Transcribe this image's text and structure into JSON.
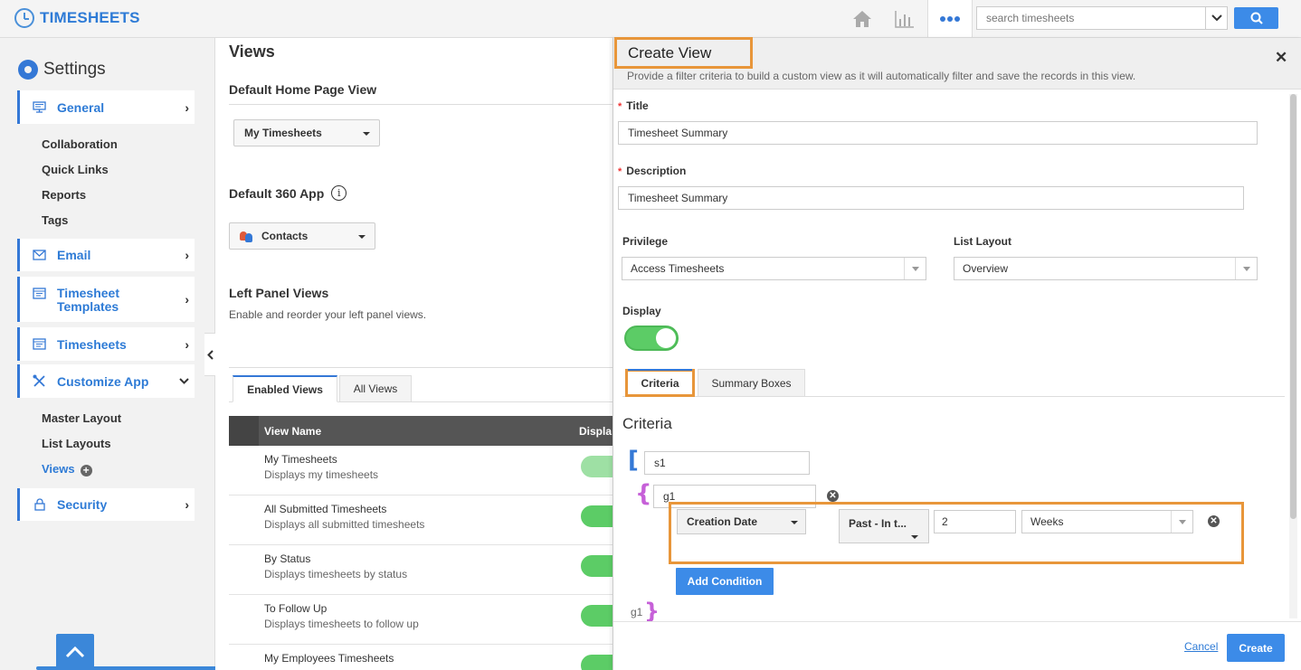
{
  "app": {
    "logo_text": "TIMESHEETS",
    "accent": "#3478d6",
    "highlight": "#e8963a"
  },
  "topbar": {
    "search_placeholder": "search timesheets",
    "icons": [
      "home-icon",
      "reports-chart-icon",
      "more-apps-icon",
      "search-icon"
    ]
  },
  "sidebar": {
    "title": "Settings",
    "general": "General",
    "general_items": [
      "Collaboration",
      "Quick Links",
      "Reports",
      "Tags"
    ],
    "email": "Email",
    "timesheet_templates": "Timesheet Templates",
    "timesheets": "Timesheets",
    "customize_app": "Customize App",
    "customize_items": [
      "Master Layout",
      "List Layouts",
      "Views"
    ],
    "security": "Security"
  },
  "main": {
    "title": "Views",
    "default_home_heading": "Default Home Page View",
    "default_home_value": "My Timesheets",
    "default_360_heading": "Default 360 App",
    "default_360_value": "Contacts",
    "left_panel_heading": "Left Panel Views",
    "left_panel_desc": "Enable and reorder your left panel views.",
    "tabs": [
      "Enabled Views",
      "All Views"
    ],
    "table_headers": {
      "name": "View Name",
      "display": "Displa"
    },
    "rows": [
      {
        "name": "My Timesheets",
        "desc": "Displays my timesheets"
      },
      {
        "name": "All Submitted Timesheets",
        "desc": "Displays all submitted timesheets"
      },
      {
        "name": "By Status",
        "desc": "Displays timesheets by status"
      },
      {
        "name": "To Follow Up",
        "desc": "Displays timesheets to follow up"
      },
      {
        "name": "My Employees Timesheets",
        "desc": ""
      }
    ]
  },
  "panel": {
    "title": "Create View",
    "subtitle": "Provide a filter criteria to build a custom view as it will automatically filter and save the records in this view.",
    "title_label": "Title",
    "title_value": "Timesheet Summary",
    "description_label": "Description",
    "description_value": "Timesheet Summary",
    "privilege_label": "Privilege",
    "privilege_value": "Access Timesheets",
    "list_layout_label": "List Layout",
    "list_layout_value": "Overview",
    "display_label": "Display",
    "display_on": true,
    "tabs": [
      "Criteria",
      "Summary Boxes"
    ],
    "criteria_heading": "Criteria",
    "set_name": "s1",
    "group_name": "g1",
    "group_end": "g1",
    "condition": {
      "field": "Creation Date",
      "operator": "Past - In t...",
      "value": "2",
      "unit": "Weeks"
    },
    "add_condition": "Add Condition",
    "cancel": "Cancel",
    "create": "Create"
  }
}
